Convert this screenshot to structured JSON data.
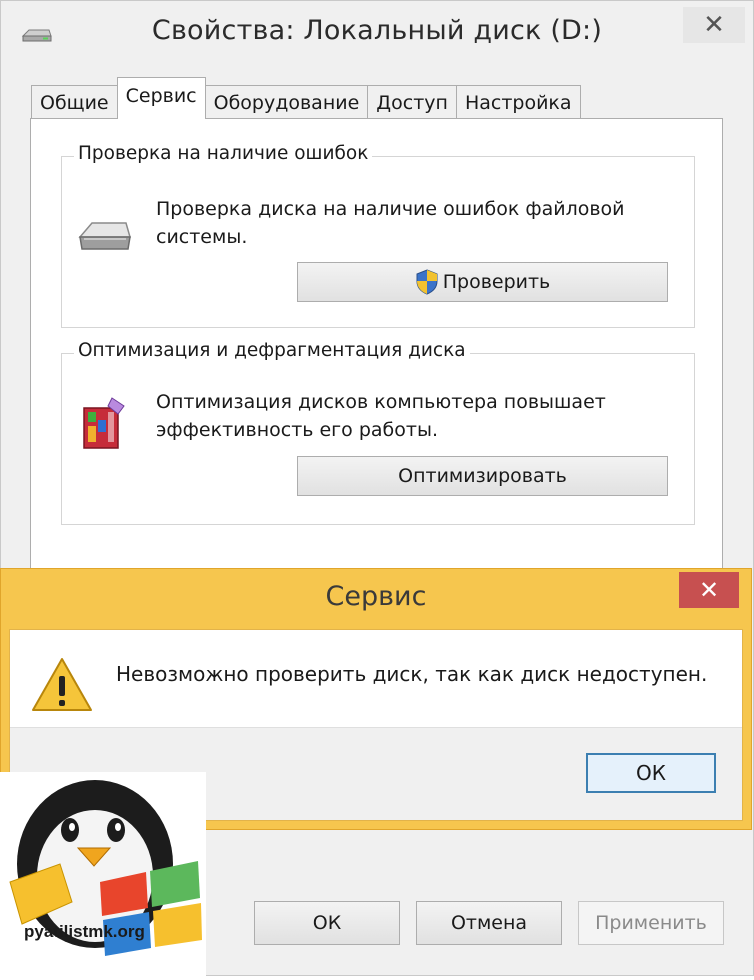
{
  "window": {
    "title": "Свойства: Локальный диск (D:)",
    "close_label": "✕"
  },
  "tabs": [
    {
      "label": "Общие"
    },
    {
      "label": "Сервис",
      "active": true
    },
    {
      "label": "Оборудование"
    },
    {
      "label": "Доступ"
    },
    {
      "label": "Настройка"
    }
  ],
  "error_check": {
    "legend": "Проверка на наличие ошибок",
    "description_line1": "Проверка диска на наличие ошибок файловой",
    "description_line2": "системы.",
    "button_label": "Проверить",
    "icon": "drive-icon"
  },
  "optimize": {
    "legend": "Оптимизация и дефрагментация диска",
    "description_line1": "Оптимизация дисков компьютера повышает",
    "description_line2": "эффективность его работы.",
    "button_label": "Оптимизировать",
    "icon": "defrag-icon"
  },
  "footer": {
    "ok_label": "ОК",
    "cancel_label": "Отмена",
    "apply_label": "Применить"
  },
  "dialog": {
    "title": "Сервис",
    "message": "Невозможно проверить диск, так как диск недоступен.",
    "ok_label": "ОК",
    "close_label": "✕",
    "icon": "warning-icon"
  },
  "watermark": {
    "text": "pyatilistmk.org"
  },
  "colors": {
    "dialog_frame": "#f6c64e",
    "close_button_red": "#c75050",
    "focus_border": "#3c7fb1"
  }
}
